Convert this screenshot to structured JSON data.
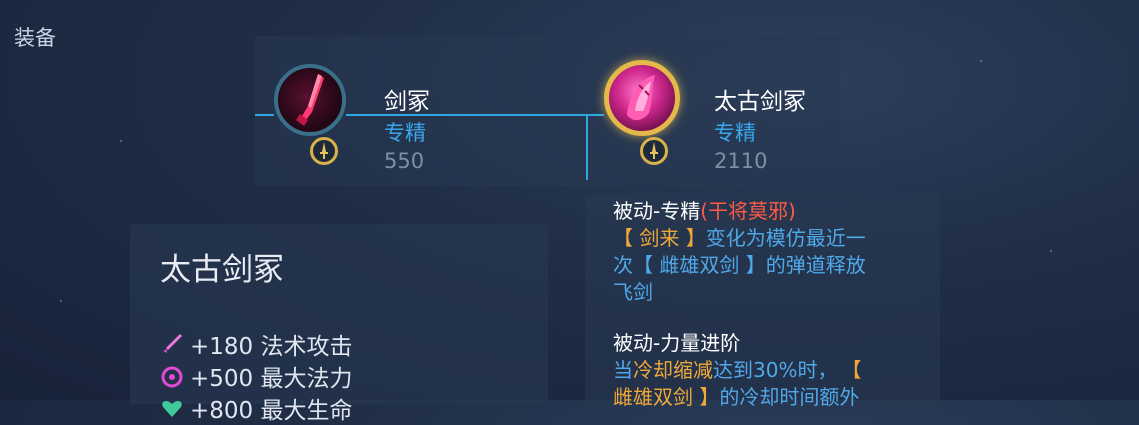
{
  "section_label": "装备",
  "items": [
    {
      "name": "剑冢",
      "type": "专精",
      "price": "550",
      "icon": "sword-shard-icon",
      "badge_icon": "sword-badge-icon"
    },
    {
      "name": "太古剑冢",
      "type": "专精",
      "price": "2110",
      "icon": "ancient-sword-icon",
      "badge_icon": "sword-badge-icon",
      "selected": true
    }
  ],
  "detail": {
    "title": "太古剑冢",
    "stats": [
      {
        "text": "+180 法术攻击",
        "icon": "magic-attack-icon"
      },
      {
        "text": "+500 最大法力",
        "icon": "max-mana-icon"
      },
      {
        "text": "+800 最大生命",
        "icon": "max-health-icon"
      }
    ],
    "passive1": {
      "title": "被动-专精",
      "tag": "(干将莫邪)",
      "line1_a": "【 剑来 】",
      "line1_b": "变化为模仿最近一",
      "line2": "次【 雌雄双剑 】的弹道释放",
      "line3": "飞剑"
    },
    "passive2": {
      "title": "被动-力量进阶",
      "line1_a": "当",
      "line1_b": "冷却缩减",
      "line1_c": "达到30%时，",
      "line1_d": "【",
      "line2_a": "雌雄双剑 】",
      "line2_b": "的冷却时间额外"
    }
  },
  "colors": {
    "accent_blue": "#39a7ee",
    "gold": "#e4b84a",
    "highlight_orange": "#f0a838",
    "tag_red": "#ff5a45"
  }
}
